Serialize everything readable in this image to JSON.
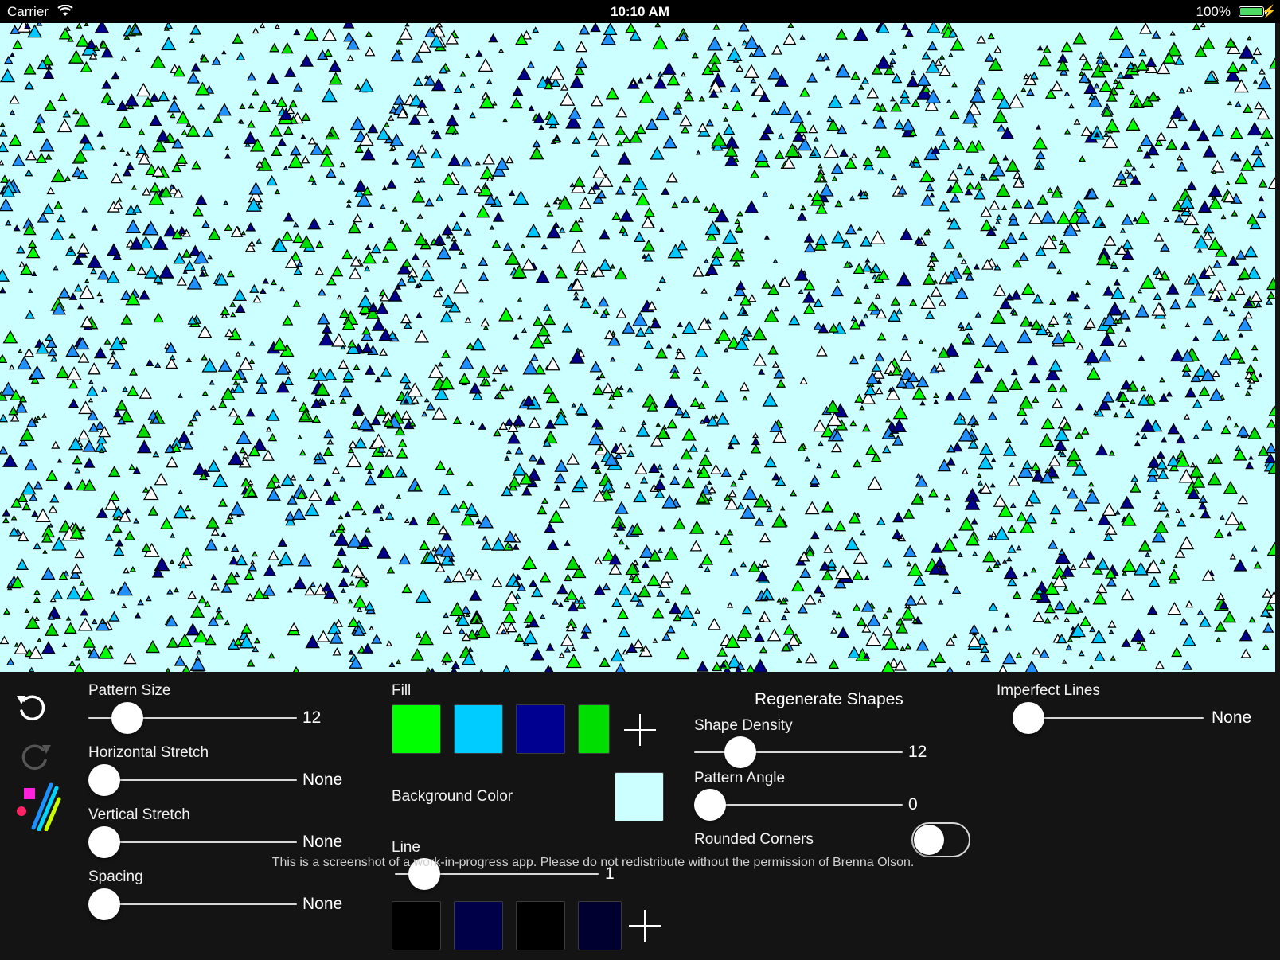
{
  "status_bar": {
    "carrier": "Carrier",
    "time": "10:10 AM",
    "battery": "100%",
    "icons": [
      "wifi-icon",
      "battery-icon",
      "charging-bolt-icon"
    ]
  },
  "canvas": {
    "background": "#ccffff",
    "shape": "triangle",
    "outline_color": "#000000",
    "fill_colors": [
      "#00ff00",
      "#00c8ff",
      "#00008b",
      "#00dd00",
      "#1e90ff",
      "#ffffff"
    ]
  },
  "toolbar": {
    "icons": [
      "undo-icon",
      "redo-icon",
      "app-logo-icon"
    ]
  },
  "controls": {
    "pattern_size": {
      "label": "Pattern Size",
      "value": "12",
      "level": 0.13
    },
    "horizontal_stretch": {
      "label": "Horizontal Stretch",
      "value": "None",
      "level": 0
    },
    "vertical_stretch": {
      "label": "Vertical Stretch",
      "value": "None",
      "level": 0
    },
    "spacing": {
      "label": "Spacing",
      "value": "None",
      "level": 0
    },
    "fill": {
      "label": "Fill",
      "swatches": [
        "#00ff00",
        "#00ccff",
        "#000090",
        "#00dd00"
      ],
      "add_icon": "plus-icon"
    },
    "background_color": {
      "label": "Background Color",
      "color": "#ccffff"
    },
    "line": {
      "label": "Line",
      "value": "1",
      "level": 0.08,
      "swatches": [
        "#000000",
        "#000048",
        "#000000",
        "#000030"
      ],
      "add_icon": "plus-icon"
    },
    "regenerate": {
      "label": "Regenerate Shapes"
    },
    "shape_density": {
      "label": "Shape Density",
      "value": "12",
      "level": 0.17
    },
    "pattern_angle": {
      "label": "Pattern Angle",
      "value": "0",
      "level": 0
    },
    "rounded_corners": {
      "label": "Rounded Corners",
      "on": false
    },
    "imperfect_lines": {
      "label": "Imperfect Lines",
      "value": "None",
      "level": 0
    }
  },
  "notice": "This is a screenshot of a work-in-progress app. Please do not redistribute without the permission of Brenna Olson."
}
